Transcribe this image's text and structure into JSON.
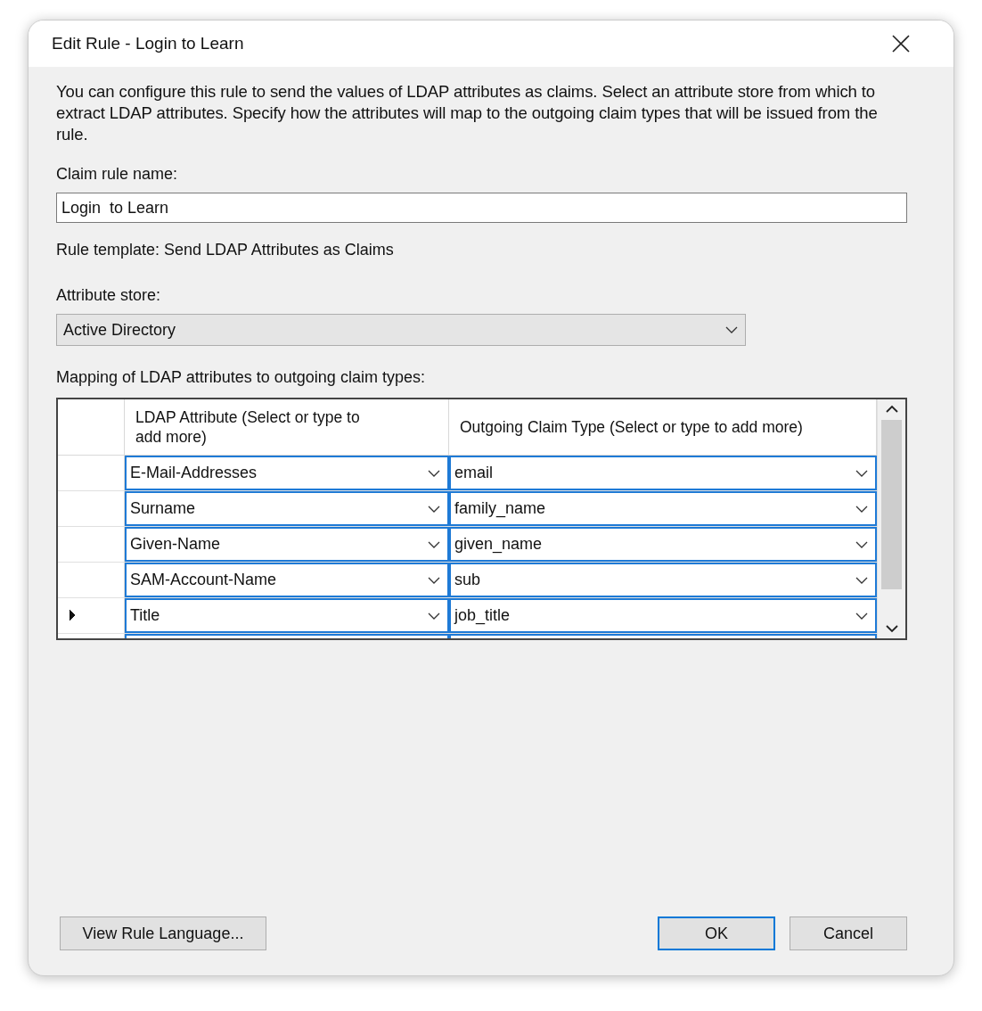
{
  "window": {
    "title": "Edit Rule - Login  to Learn"
  },
  "description": "You can configure this rule to send the values of LDAP attributes as claims. Select an attribute store from which to extract LDAP attributes. Specify how the attributes will map to the outgoing claim types that will be issued from the rule.",
  "claim_rule_name": {
    "label": "Claim rule name:",
    "value": "Login  to Learn"
  },
  "rule_template": "Rule template: Send LDAP Attributes as Claims",
  "attribute_store": {
    "label": "Attribute store:",
    "value": "Active Directory"
  },
  "mapping": {
    "label": "Mapping of LDAP attributes to outgoing claim types:",
    "columns": [
      "LDAP Attribute (Select or type to add more)",
      "Outgoing Claim Type (Select or type to add more)"
    ],
    "rows": [
      {
        "ldap_attribute": "E-Mail-Addresses",
        "claim_type": "email",
        "selected": false
      },
      {
        "ldap_attribute": "Surname",
        "claim_type": "family_name",
        "selected": false
      },
      {
        "ldap_attribute": "Given-Name",
        "claim_type": "given_name",
        "selected": false
      },
      {
        "ldap_attribute": "SAM-Account-Name",
        "claim_type": "sub",
        "selected": false
      },
      {
        "ldap_attribute": "Title",
        "claim_type": "job_title",
        "selected": true
      }
    ]
  },
  "buttons": [
    {
      "label": "View Rule Language...",
      "kind": "secondary"
    },
    {
      "label": "OK",
      "kind": "default"
    },
    {
      "label": "Cancel",
      "kind": "secondary"
    }
  ]
}
